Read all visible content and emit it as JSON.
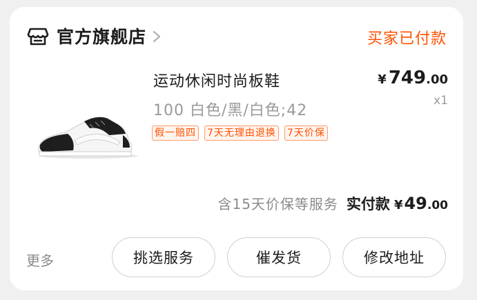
{
  "order": {
    "shop_name": "官方旗舰店",
    "status": "买家已付款",
    "product": {
      "title": "运动休闲时尚板鞋",
      "sku": "100 白色/黑/白色;42",
      "tags": [
        "假一赔四",
        "7天无理由退换",
        "7天价保"
      ],
      "price_currency": "¥",
      "price_int": "749",
      "price_dec": ".00",
      "quantity": "x1"
    },
    "summary": {
      "note": "含15天价保等服务",
      "label": "实付款",
      "currency": "¥",
      "amount_int": "49",
      "amount_dec": ".00"
    }
  },
  "actions": {
    "more": "更多",
    "buttons": [
      "挑选服务",
      "催发货",
      "修改地址"
    ]
  },
  "colors": {
    "accent": "#ff5000",
    "text": "#1c1c1c",
    "muted": "#9a9a9a",
    "background": "#f0f0f0"
  },
  "icons": [
    "store-icon",
    "chevron-right-icon",
    "sneaker-image"
  ]
}
